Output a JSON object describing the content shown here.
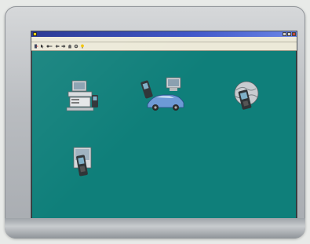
{
  "window": {
    "title": "",
    "min_icon": "minimize-icon",
    "max_icon": "maximize-icon",
    "close_icon": "close-icon"
  },
  "menu": {
    "items": [
      "",
      "",
      ""
    ]
  },
  "toolbar": {
    "icons": [
      "exit-door-icon",
      "help-cursor-icon",
      "key-icon",
      "back-arrow-icon",
      "forward-arrow-icon",
      "home-icon",
      "settings-gear-icon",
      "lightbulb-icon"
    ]
  },
  "apps": [
    {
      "label": "",
      "icon": "computer-workstation-icon"
    },
    {
      "label": "",
      "icon": "vehicle-diagnostic-icon"
    },
    {
      "label": "",
      "icon": "handheld-scanner-globe-icon"
    },
    {
      "label": "",
      "icon": "handheld-scanner-icon"
    }
  ],
  "status": {
    "left": "",
    "cells": [
      "",
      ""
    ]
  },
  "bezel": {
    "brand": ""
  },
  "colors": {
    "desktop": "#0f7f7a",
    "titlebar": "#2a3fb0",
    "chrome": "#ece9d8",
    "bezel": "#b9bcc0"
  }
}
